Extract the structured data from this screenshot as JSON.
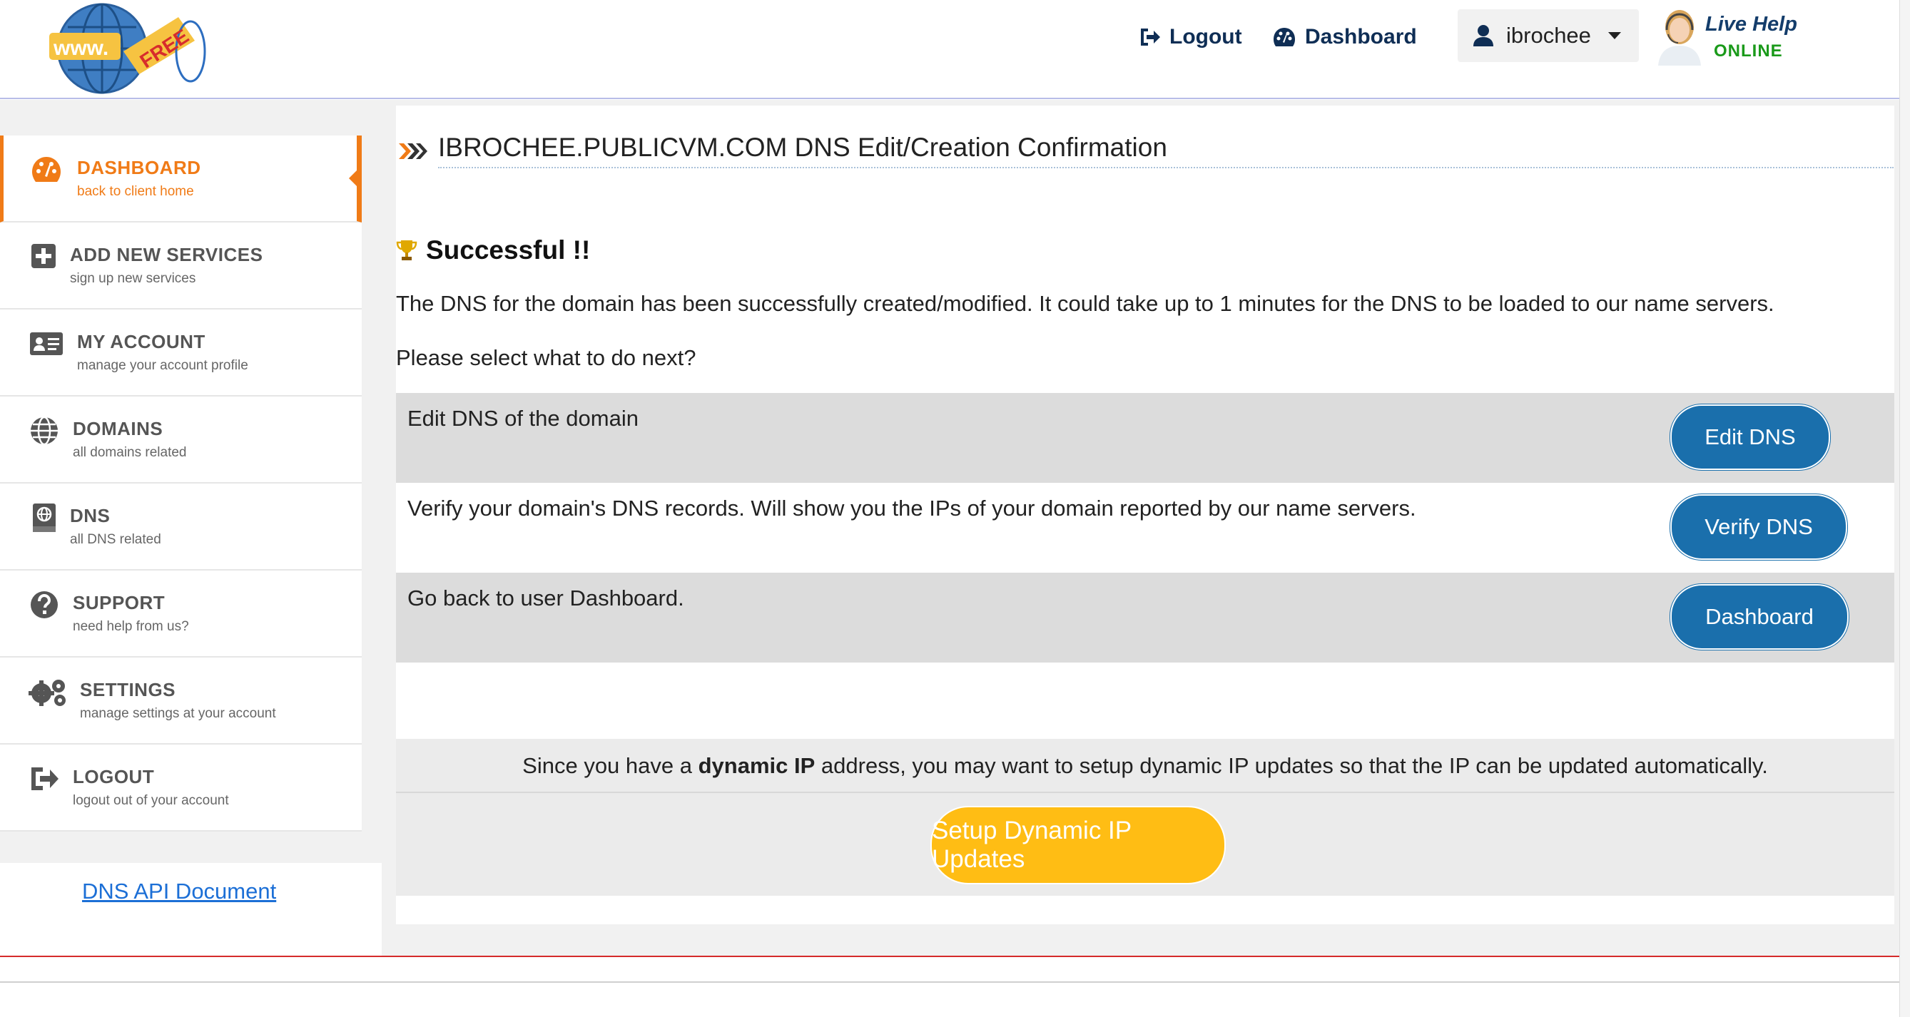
{
  "header": {
    "logo_alt": "www. FREE",
    "logo_text": "www.",
    "logo_tag": "FREE",
    "logout_label": "Logout",
    "dashboard_label": "Dashboard",
    "username": "ibrochee",
    "live_help_title": "Live Help",
    "live_help_status": "ONLINE"
  },
  "sidebar": {
    "items": [
      {
        "title": "DASHBOARD",
        "sub": "back to client home",
        "icon": "dashboard-icon",
        "active": true
      },
      {
        "title": "ADD NEW SERVICES",
        "sub": "sign up new services",
        "icon": "plus-square-icon"
      },
      {
        "title": "MY ACCOUNT",
        "sub": "manage your account profile",
        "icon": "id-card-icon"
      },
      {
        "title": "DOMAINS",
        "sub": "all domains related",
        "icon": "globe-icon"
      },
      {
        "title": "DNS",
        "sub": "all DNS related",
        "icon": "dns-book-icon"
      },
      {
        "title": "SUPPORT",
        "sub": "need help from us?",
        "icon": "question-icon"
      },
      {
        "title": "SETTINGS",
        "sub": "manage settings at your account",
        "icon": "gears-icon"
      },
      {
        "title": "LOGOUT",
        "sub": "logout out of your account",
        "icon": "logout-icon"
      }
    ],
    "api_link": "DNS API Document"
  },
  "main": {
    "title": "IBROCHEE.PUBLICVM.COM DNS Edit/Creation Confirmation",
    "success_heading": "Successful !!",
    "message": "The DNS for the domain has been successfully created/modified. It could take up to 1 minutes for the DNS to be loaded to our name servers.",
    "prompt": "Please select what to do next?",
    "options": [
      {
        "text": "Edit DNS of the domain",
        "button": "Edit DNS"
      },
      {
        "text": "Verify your domain's DNS records. Will show you the IPs of your domain reported by our name servers.",
        "button": "Verify DNS"
      },
      {
        "text": "Go back to user Dashboard.",
        "button": "Dashboard"
      }
    ],
    "dynamic_prefix": "Since you have a ",
    "dynamic_bold": "dynamic IP",
    "dynamic_suffix": " address, you may want to setup dynamic IP updates so that the IP can be updated automatically.",
    "dynamic_button": "Setup Dynamic IP Updates"
  },
  "colors": {
    "accent_orange": "#f07b17",
    "button_blue": "#1a6fac",
    "button_yellow": "#ffbd14",
    "nav_text": "#0f2e55",
    "online_green": "#1a9a1a"
  }
}
